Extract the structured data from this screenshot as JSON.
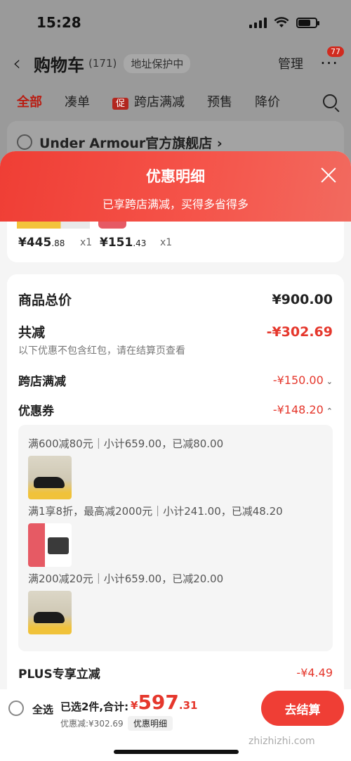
{
  "status": {
    "time": "15:28"
  },
  "nav": {
    "title": "购物车",
    "count": "(171)",
    "address_chip": "地址保护中",
    "manage": "管理",
    "more_badge": "77"
  },
  "tabs": {
    "all": "全部",
    "bundle": "凑单",
    "promo_tag": "促",
    "cross_store": "跨店满减",
    "presale": "预售",
    "price_drop": "降价"
  },
  "store": {
    "name": "Under Armour官方旗舰店 ›"
  },
  "sheet": {
    "title": "优惠明细",
    "subtitle": "已享跨店满减，买得多省得多",
    "items": [
      {
        "price_int": "¥445",
        "price_dec": ".88",
        "qty": "x1"
      },
      {
        "price_int": "¥151",
        "price_dec": ".43",
        "qty": "x1"
      }
    ],
    "total_label": "商品总价",
    "total_value": "¥900.00",
    "reduce_label": "共减",
    "reduce_value": "-¥302.69",
    "reduce_hint": "以下优惠不包含红包，请在结算页查看",
    "cross_label": "跨店满减",
    "cross_value": "-¥150.00",
    "coupon_label": "优惠券",
    "coupon_value": "-¥148.20",
    "coupon_rows": [
      "满600减80元｜小计659.00，已减80.00",
      "满1享8折，最高减2000元｜小计241.00，已减48.20",
      "满200减20元｜小计659.00，已减20.00"
    ],
    "plus_label": "PLUS专享立减",
    "plus_value": "-¥4.49"
  },
  "bottom": {
    "select_all": "全选",
    "selected": "已选2件,合计:",
    "currency": "¥",
    "total_int": "597",
    "total_dec": ".31",
    "discount": "优惠减:¥302.69",
    "detail": "优惠明细",
    "checkout": "去结算",
    "watermark": "zhizhizhi.com"
  }
}
